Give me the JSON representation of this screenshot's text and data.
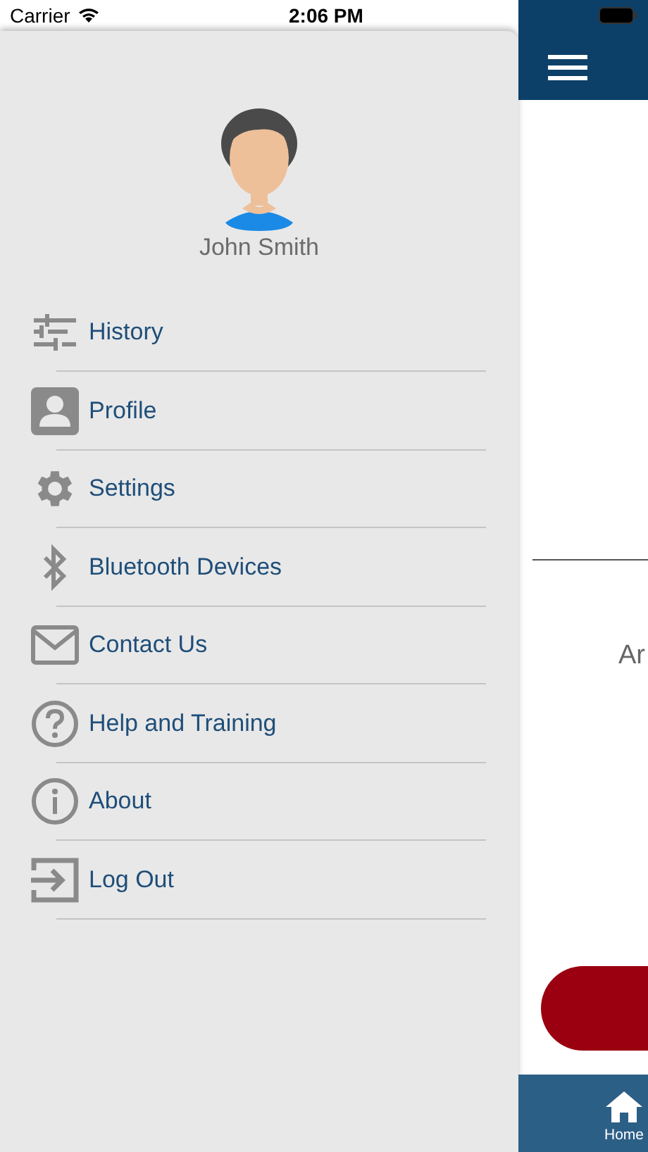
{
  "status_bar": {
    "carrier": "Carrier",
    "time": "2:06 PM"
  },
  "profile": {
    "name": "John Smith"
  },
  "menu": [
    {
      "label": "History",
      "kind": "sliders"
    },
    {
      "label": "Profile",
      "kind": "profile"
    },
    {
      "label": "Settings",
      "kind": "gear"
    },
    {
      "label": "Bluetooth Devices",
      "kind": "bluetooth"
    },
    {
      "label": "Contact Us",
      "kind": "mail"
    },
    {
      "label": "Help and Training",
      "kind": "help"
    },
    {
      "label": "About",
      "kind": "info"
    },
    {
      "label": "Log Out",
      "kind": "logout"
    }
  ],
  "content": {
    "text": "Ar"
  },
  "tab_bar": [
    {
      "label": "Home"
    }
  ]
}
